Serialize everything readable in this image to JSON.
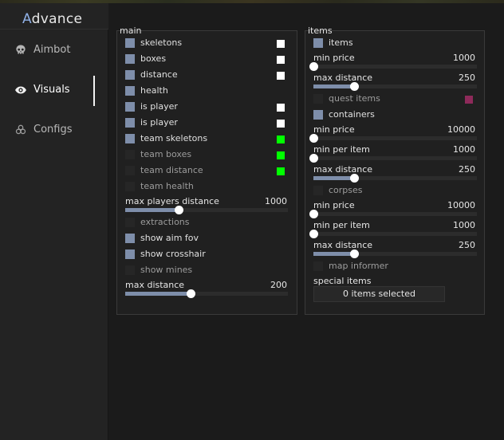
{
  "app": {
    "title_accent": "A",
    "title_rest": "dvance"
  },
  "sidebar": {
    "items": [
      {
        "label": "Aimbot",
        "icon": "skull-icon"
      },
      {
        "label": "Visuals",
        "icon": "eye-icon",
        "active": true
      },
      {
        "label": "Configs",
        "icon": "biohazard-icon"
      }
    ]
  },
  "main_panel": {
    "title": "main",
    "options": [
      {
        "label": "skeletons",
        "checked": true,
        "color": "#ffffff"
      },
      {
        "label": "boxes",
        "checked": true,
        "color": "#ffffff"
      },
      {
        "label": "distance",
        "checked": true,
        "color": "#ffffff"
      },
      {
        "label": "health",
        "checked": true
      },
      {
        "label": "is player",
        "checked": true,
        "color": "#ffffff"
      },
      {
        "label": "is player",
        "checked": true,
        "color": "#ffffff"
      },
      {
        "label": "team skeletons",
        "checked": true,
        "color": "#00ff00"
      },
      {
        "label": "team boxes",
        "checked": false,
        "color": "#00ff00"
      },
      {
        "label": "team distance",
        "checked": false,
        "color": "#00ff00"
      },
      {
        "label": "team health",
        "checked": false
      }
    ],
    "max_players_distance": {
      "label": "max players distance",
      "value": "1000",
      "fraction": 0.33
    },
    "extractions": {
      "label": "extractions",
      "checked": false
    },
    "show_aim_fov": {
      "label": "show aim fov",
      "checked": true
    },
    "show_crosshair": {
      "label": "show crosshair",
      "checked": true
    },
    "show_mines": {
      "label": "show mines",
      "checked": false
    },
    "max_distance": {
      "label": "max distance",
      "value": "200",
      "fraction": 0.4
    }
  },
  "items_panel": {
    "title": "items",
    "items_toggle": {
      "label": "items",
      "checked": true
    },
    "min_price": {
      "label": "min price",
      "value": "1000",
      "fraction": 0.0
    },
    "max_distance": {
      "label": "max distance",
      "value": "250",
      "fraction": 0.25
    },
    "quest_items": {
      "label": "quest items",
      "checked": false,
      "color": "#8e2a5a"
    },
    "containers": {
      "label": "containers",
      "checked": true
    },
    "containers_min_price": {
      "label": "min price",
      "value": "10000",
      "fraction": 0.0
    },
    "containers_min_per_item": {
      "label": "min per item",
      "value": "1000",
      "fraction": 0.0
    },
    "containers_max_distance": {
      "label": "max distance",
      "value": "250",
      "fraction": 0.25
    },
    "corpses": {
      "label": "corpses",
      "checked": false
    },
    "corpses_min_price": {
      "label": "min price",
      "value": "10000",
      "fraction": 0.0
    },
    "corpses_min_per_item": {
      "label": "min per item",
      "value": "1000",
      "fraction": 0.0
    },
    "corpses_max_distance": {
      "label": "max distance",
      "value": "250",
      "fraction": 0.25
    },
    "map_informer": {
      "label": "map informer",
      "checked": false
    },
    "special_items": {
      "label": "special items",
      "selected_text": "0 items selected"
    }
  }
}
